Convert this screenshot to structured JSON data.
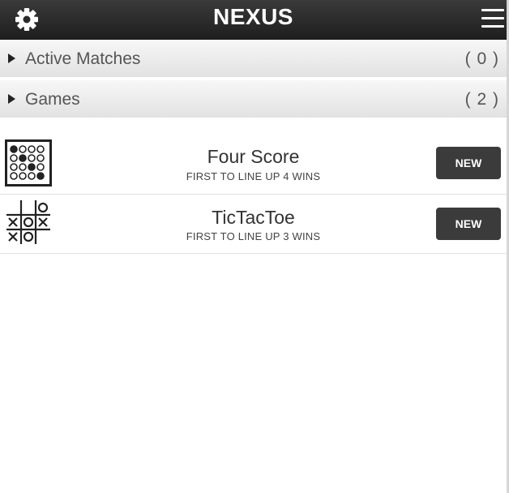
{
  "header": {
    "title": "NEXUS",
    "settings_icon": "gear-icon",
    "menu_icon": "hamburger-menu-icon"
  },
  "sections": [
    {
      "label": "Active Matches",
      "count": "( 0 )"
    },
    {
      "label": "Games",
      "count": "( 2 )"
    }
  ],
  "games": [
    {
      "name": "Four Score",
      "subtitle": "FIRST TO LINE UP 4 WINS",
      "button": "NEW",
      "icon": "four-score-board-icon"
    },
    {
      "name": "TicTacToe",
      "subtitle": "FIRST TO LINE UP 3 WINS",
      "button": "NEW",
      "icon": "tictactoe-board-icon"
    }
  ],
  "colors": {
    "header_bg": "#2b2b2b",
    "section_bg": "#ececec",
    "button_bg": "#3b3b3b"
  }
}
